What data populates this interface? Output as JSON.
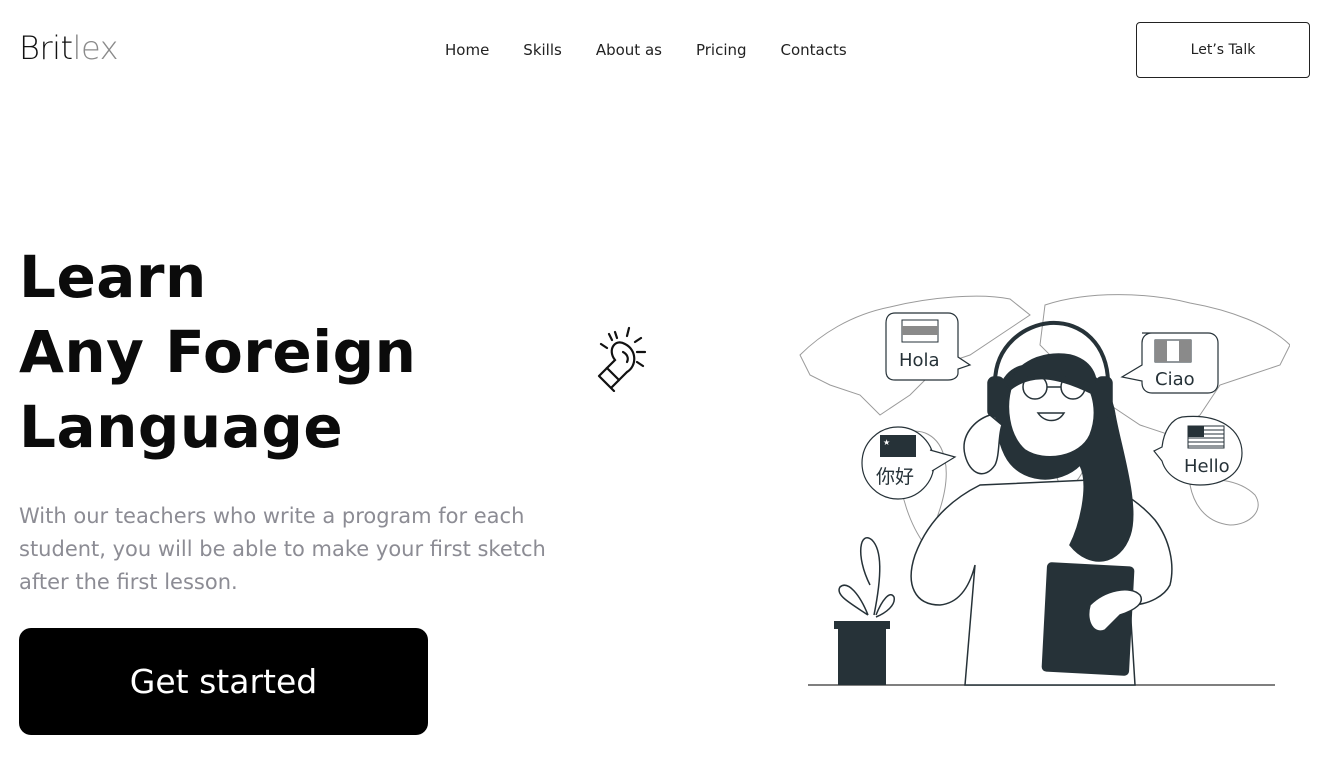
{
  "brand": {
    "part1": "Brit",
    "part2": "lex"
  },
  "nav": {
    "items": [
      "Home",
      "Skills",
      "About as",
      "Pricing",
      "Contacts"
    ]
  },
  "header": {
    "cta_label": "Let’s Talk"
  },
  "hero": {
    "title_lines": [
      "Learn",
      "Any Foreign",
      "Language"
    ],
    "text": "With our teachers who write a program for each student, you will be able to make your first sketch after the first lesson.",
    "cta_label": "Get started"
  },
  "illustration": {
    "bubbles": [
      "Hola",
      "Ciao",
      "你好",
      "Hello"
    ]
  },
  "colors": {
    "accent": "#000000",
    "muted_text": "#8c8c94",
    "ink": "#263238"
  },
  "icons": [
    "lightbulb-icon"
  ]
}
